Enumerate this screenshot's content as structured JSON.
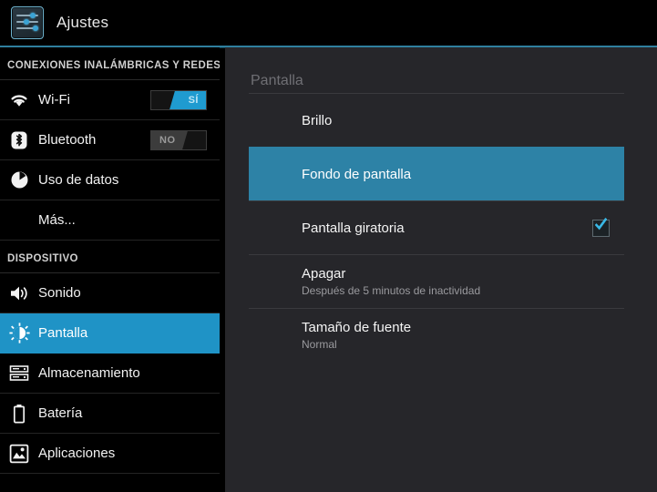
{
  "header": {
    "title": "Ajustes",
    "icon": "settings-sliders-icon",
    "accent_color": "#2f7f9e"
  },
  "sidebar": {
    "sections": [
      {
        "label": "CONEXIONES INALÁMBRICAS Y REDES",
        "items": [
          {
            "label": "Wi-Fi",
            "icon": "wifi-icon",
            "toggle": {
              "state": "on",
              "label": "SÍ"
            }
          },
          {
            "label": "Bluetooth",
            "icon": "bluetooth-icon",
            "toggle": {
              "state": "off",
              "label": "NO"
            }
          },
          {
            "label": "Uso de datos",
            "icon": "data-usage-icon"
          },
          {
            "label": "Más...",
            "icon": null
          }
        ]
      },
      {
        "label": "DISPOSITIVO",
        "items": [
          {
            "label": "Sonido",
            "icon": "sound-icon"
          },
          {
            "label": "Pantalla",
            "icon": "display-brightness-icon",
            "selected": true
          },
          {
            "label": "Almacenamiento",
            "icon": "storage-icon"
          },
          {
            "label": "Batería",
            "icon": "battery-icon"
          },
          {
            "label": "Aplicaciones",
            "icon": "applications-icon"
          }
        ]
      }
    ],
    "selected_color": "#1f93c6"
  },
  "content": {
    "title": "Pantalla",
    "highlight_color": "#2d82a6",
    "rows": [
      {
        "title": "Brillo"
      },
      {
        "title": "Fondo de pantalla",
        "highlighted": true
      },
      {
        "title": "Pantalla giratoria",
        "checkbox": true,
        "checked": true
      },
      {
        "title": "Apagar",
        "subtitle": "Después de 5 minutos de inactividad"
      },
      {
        "title": "Tamaño de fuente",
        "subtitle": "Normal"
      }
    ]
  }
}
